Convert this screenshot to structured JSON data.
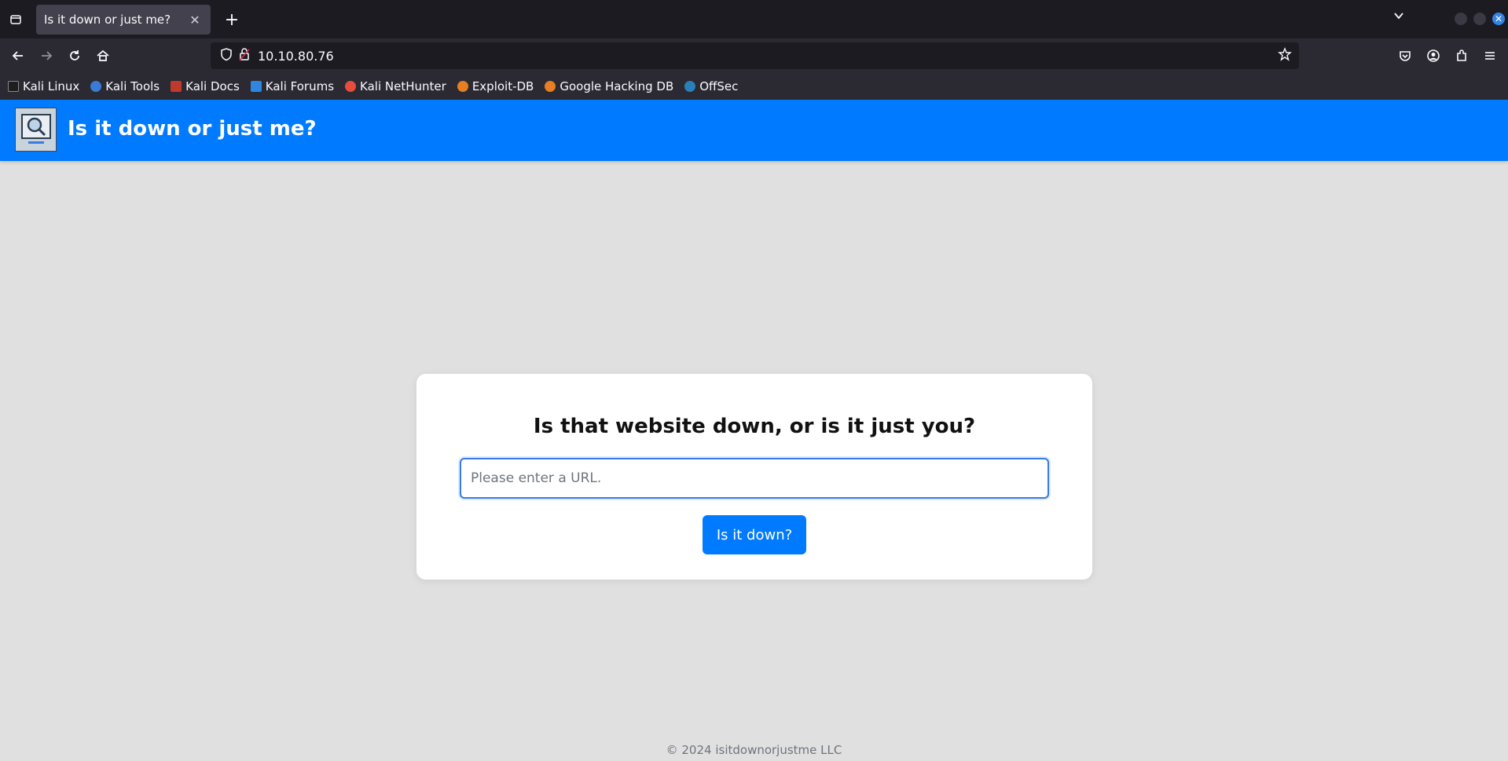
{
  "browser": {
    "tab_title": "Is it down or just me?",
    "address": "10.10.80.76",
    "bookmarks": [
      {
        "label": "Kali Linux",
        "color": "#1e1e1e"
      },
      {
        "label": "Kali Tools",
        "color": "#3a7bd5"
      },
      {
        "label": "Kali Docs",
        "color": "#c0392b"
      },
      {
        "label": "Kali Forums",
        "color": "#2e86de"
      },
      {
        "label": "Kali NetHunter",
        "color": "#e74c3c"
      },
      {
        "label": "Exploit-DB",
        "color": "#e67e22"
      },
      {
        "label": "Google Hacking DB",
        "color": "#e67e22"
      },
      {
        "label": "OffSec",
        "color": "#2980b9"
      }
    ]
  },
  "site": {
    "title": "Is it down or just me?",
    "accent": "#007bff"
  },
  "card": {
    "heading": "Is that website down, or is it just you?",
    "input_placeholder": "Please enter a URL.",
    "button_label": "Is it down?"
  },
  "footer": {
    "text": "© 2024 isitdownorjustme LLC"
  }
}
